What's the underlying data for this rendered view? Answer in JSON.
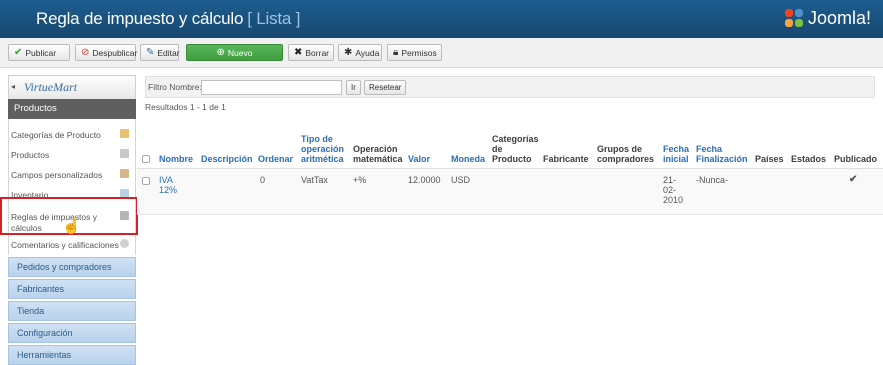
{
  "header": {
    "title": "Regla de impuesto y cálculo",
    "subtitle": "[ Lista ]",
    "brand": "Joomla!"
  },
  "toolbar": {
    "publish": "Publicar",
    "unpublish": "Despublicar",
    "edit": "Editar",
    "new": "Nuevo",
    "delete": "Borrar",
    "help": "Ayuda",
    "permissions": "Permisos"
  },
  "sidebar": {
    "logo": "VirtueMart",
    "section": "Productos",
    "items": [
      {
        "label": "Categorías de Producto"
      },
      {
        "label": "Productos"
      },
      {
        "label": "Campos personalizados"
      },
      {
        "label": "Inventario"
      },
      {
        "label": "Reglas de impuestos y cálculos"
      },
      {
        "label": "Comentarios y calificaciones"
      }
    ],
    "groups": [
      {
        "label": "Pedidos y compradores"
      },
      {
        "label": "Fabricantes"
      },
      {
        "label": "Tienda"
      },
      {
        "label": "Configuración"
      },
      {
        "label": "Herramientas"
      }
    ]
  },
  "filter": {
    "label": "Filtro Nombre:",
    "value": "",
    "go": "Ir",
    "reset": "Resetear"
  },
  "results": "Resultados 1 - 1 de 1",
  "table": {
    "headers": {
      "nombre": "Nombre",
      "descripcion": "Descripción",
      "ordenar": "Ordenar",
      "tipo_1": "Tipo de",
      "tipo_2": "operación",
      "tipo_3": "aritmética",
      "op_1": "Operación",
      "op_2": "matemática",
      "valor": "Valor",
      "moneda": "Moneda",
      "cat_1": "Categorías",
      "cat_2": "de",
      "cat_3": "Producto",
      "fabricante": "Fabricante",
      "grupos_1": "Grupos de",
      "grupos_2": "compradores",
      "fi_1": "Fecha",
      "fi_2": "inicial",
      "ff_1": "Fecha",
      "ff_2": "Finalización",
      "paises": "Países",
      "estados": "Estados",
      "publicado": "Publicado"
    },
    "row": {
      "nombre_1": "IVA",
      "nombre_2": "12%",
      "ordenar": "0",
      "tipo": "VatTax",
      "op": "+%",
      "valor": "12.0000",
      "moneda": "USD",
      "fi_1": "21-",
      "fi_2": "02-",
      "fi_3": "2010",
      "ff": "-Nunca-",
      "publicado_icon": "check-icon"
    }
  },
  "colors": {
    "header_bg": "#1d5d8f",
    "highlight": "#d61f26",
    "link": "#2a6fb5",
    "nuevo_btn": "#4aa84a"
  }
}
